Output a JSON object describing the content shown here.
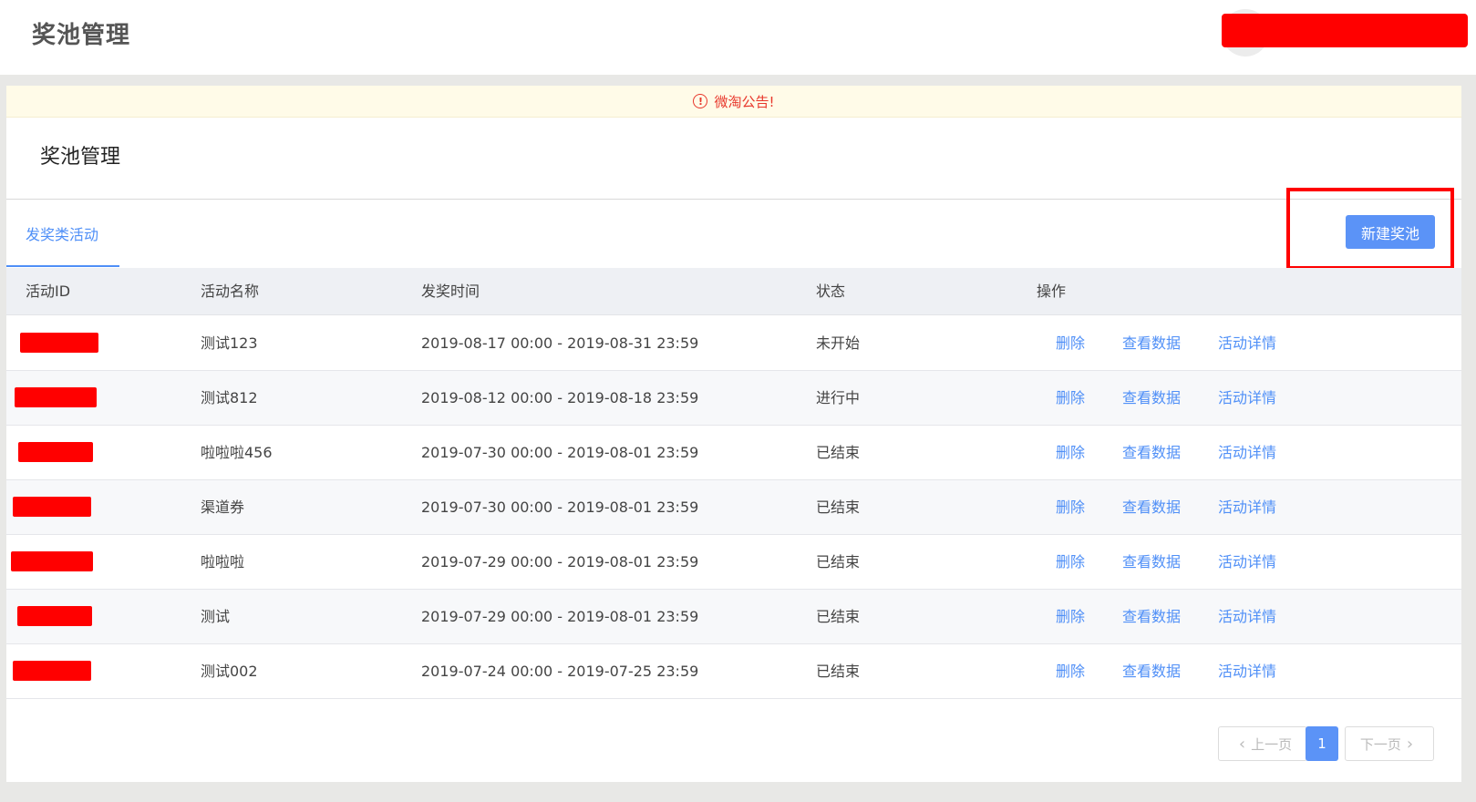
{
  "header": {
    "app_title": "奖池管理"
  },
  "notice": {
    "icon": "alert-circle-icon",
    "text": "微淘公告!"
  },
  "page": {
    "title": "奖池管理",
    "tab_label": "发奖类活动",
    "new_button_label": "新建奖池"
  },
  "table": {
    "columns": [
      "活动ID",
      "活动名称",
      "发奖时间",
      "状态",
      "操作"
    ],
    "actions": [
      "删除",
      "查看数据",
      "活动详情"
    ],
    "rows": [
      {
        "name": "测试123",
        "time": "2019-08-17 00:00 - 2019-08-31 23:59",
        "status": "未开始"
      },
      {
        "name": "测试812",
        "time": "2019-08-12 00:00 - 2019-08-18 23:59",
        "status": "进行中"
      },
      {
        "name": "啦啦啦456",
        "time": "2019-07-30 00:00 - 2019-08-01 23:59",
        "status": "已结束"
      },
      {
        "name": "渠道券",
        "time": "2019-07-30 00:00 - 2019-08-01 23:59",
        "status": "已结束"
      },
      {
        "name": "啦啦啦",
        "time": "2019-07-29 00:00 - 2019-08-01 23:59",
        "status": "已结束"
      },
      {
        "name": "测试",
        "time": "2019-07-29 00:00 - 2019-08-01 23:59",
        "status": "已结束"
      },
      {
        "name": "测试002",
        "time": "2019-07-24 00:00 - 2019-07-25 23:59",
        "status": "已结束"
      }
    ]
  },
  "pagination": {
    "prev_label": "上一页",
    "current_page": "1",
    "next_label": "下一页"
  },
  "colors": {
    "accent": "#5b93f7",
    "link": "#4f8ff7",
    "notice_text": "#e8372b",
    "highlight": "#ff0000"
  }
}
